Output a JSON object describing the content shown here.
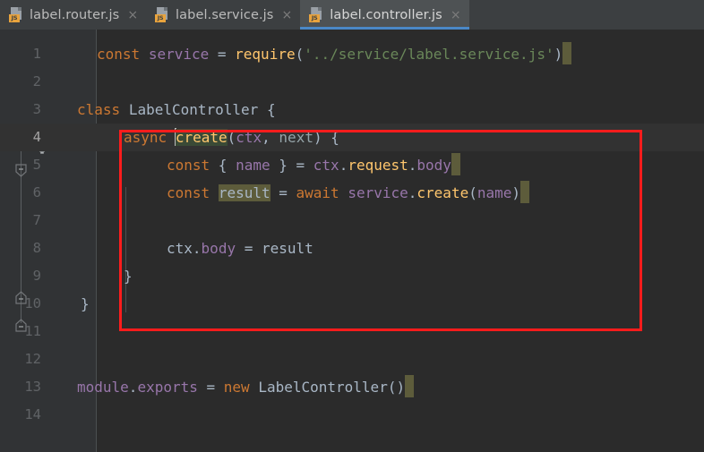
{
  "window": {
    "background": "#3c3f41",
    "editor_background": "#2b2b2b",
    "gutter_background": "#313335",
    "accent_blue": "#4a88c7",
    "annotation_red": "#fb1c1c"
  },
  "tabs": [
    {
      "label": "label.router.js",
      "icon": "js-file-icon",
      "badge": "JS",
      "close": "×",
      "active": false
    },
    {
      "label": "label.service.js",
      "icon": "js-file-icon",
      "badge": "JS",
      "close": "×",
      "active": false
    },
    {
      "label": "label.controller.js",
      "icon": "js-file-icon",
      "badge": "JS",
      "close": "×",
      "active": true
    }
  ],
  "editor": {
    "line_numbers": [
      "1",
      "2",
      "3",
      "4",
      "5",
      "6",
      "7",
      "8",
      "9",
      "10",
      "11",
      "12",
      "13",
      "14"
    ],
    "current_line": 4,
    "gutter_icons": {
      "line_4": "lightbulb-icon",
      "fold_open_lines": [
        3,
        4
      ],
      "fold_close_lines": [
        9,
        10
      ]
    },
    "lines": [
      {
        "n": 1,
        "text": "const service = require('../service/label.service.js')"
      },
      {
        "n": 2,
        "text": ""
      },
      {
        "n": 3,
        "text": "class LabelController {"
      },
      {
        "n": 4,
        "text": "    async create(ctx, next) {"
      },
      {
        "n": 5,
        "text": "        const { name } = ctx.request.body"
      },
      {
        "n": 6,
        "text": "        const result = await service.create(name)"
      },
      {
        "n": 7,
        "text": ""
      },
      {
        "n": 8,
        "text": "        ctx.body = result"
      },
      {
        "n": 9,
        "text": "    }"
      },
      {
        "n": 10,
        "text": "}"
      },
      {
        "n": 11,
        "text": ""
      },
      {
        "n": 12,
        "text": ""
      },
      {
        "n": 13,
        "text": "module.exports = new LabelController()"
      },
      {
        "n": 14,
        "text": ""
      }
    ],
    "tokens": {
      "l1": [
        "const",
        " ",
        "service",
        " = ",
        "require",
        "(",
        "'../service/label.service.js'",
        ")"
      ],
      "l3": [
        "class",
        " ",
        "LabelController",
        " {"
      ],
      "l4": [
        "async",
        " ",
        "create",
        "(",
        "ctx",
        ", ",
        "next",
        ") {"
      ],
      "l5": [
        "const",
        " { ",
        "name",
        " } = ",
        "ctx",
        ".",
        "request",
        ".",
        "body"
      ],
      "l6": [
        "const",
        " ",
        "result",
        " = ",
        "await",
        " ",
        "service",
        ".",
        "create",
        "(",
        "name",
        ")"
      ],
      "l8": [
        "ctx",
        ".",
        "body",
        " = ",
        "result"
      ],
      "l9": [
        "}"
      ],
      "l10": [
        "}"
      ],
      "l13": [
        "module",
        ".",
        "exports",
        " = ",
        "new",
        " ",
        "LabelController",
        "()"
      ]
    },
    "highlights": {
      "create_identifier": "#3a4a36",
      "result_write_usage": "#5d5c3b",
      "trailing_blocks": "#5d5c3b"
    },
    "annotation": {
      "shape": "rectangle",
      "color": "#fb1c1c",
      "covers_lines": "4-9"
    }
  }
}
